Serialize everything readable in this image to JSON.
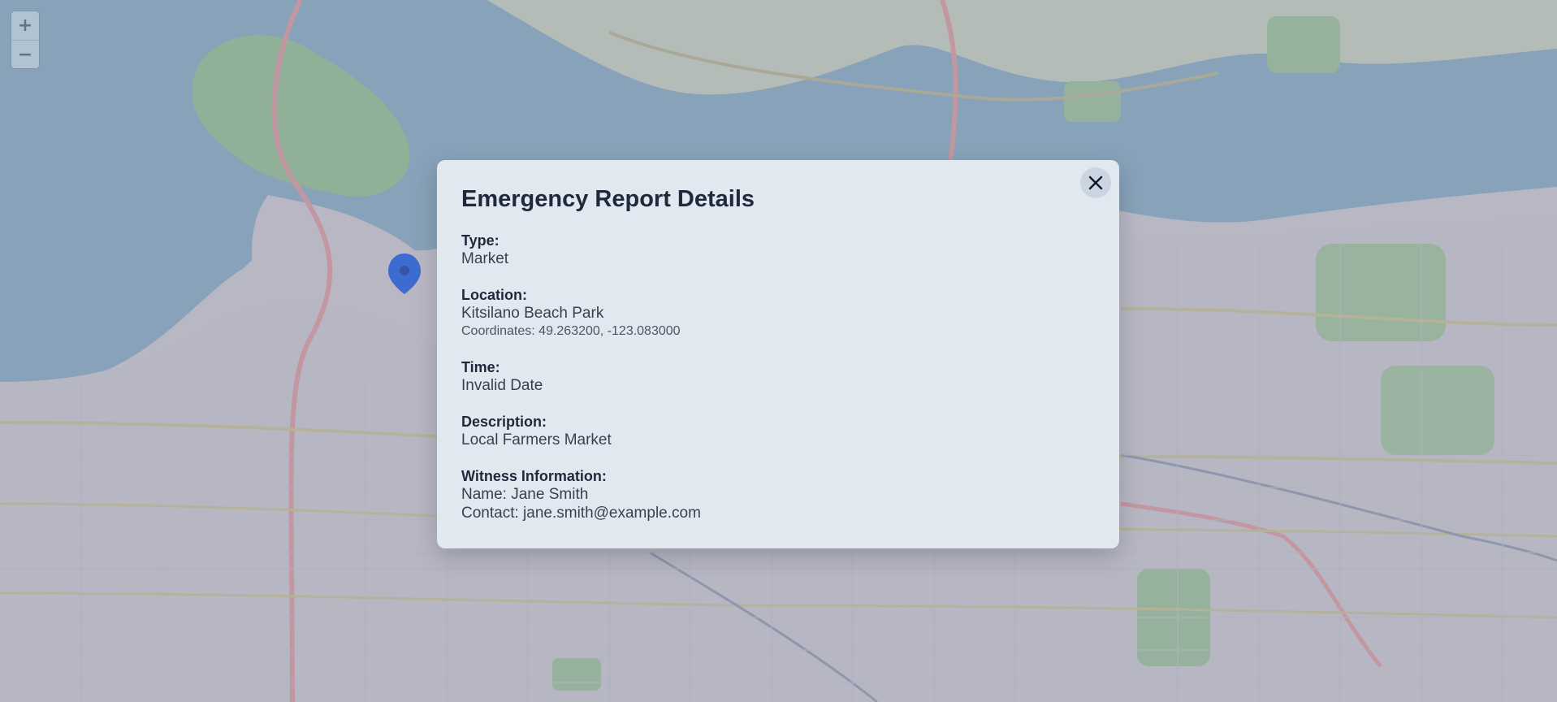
{
  "map": {
    "zoom_in_label": "+",
    "zoom_out_label": "−",
    "marker_icon": "map-pin-icon",
    "marker_color": "#2563eb"
  },
  "modal": {
    "title": "Emergency Report Details",
    "close_icon": "close-icon",
    "background": "#e2e8f0",
    "type": {
      "label": "Type:",
      "value": "Market"
    },
    "location": {
      "label": "Location:",
      "value": "Kitsilano Beach Park",
      "coordinates": "Coordinates: 49.263200, -123.083000"
    },
    "time": {
      "label": "Time:",
      "value": "Invalid Date"
    },
    "description": {
      "label": "Description:",
      "value": "Local Farmers Market"
    },
    "witness": {
      "label": "Witness Information:",
      "name": "Name: Jane Smith",
      "contact": "Contact: jane.smith@example.com"
    }
  }
}
